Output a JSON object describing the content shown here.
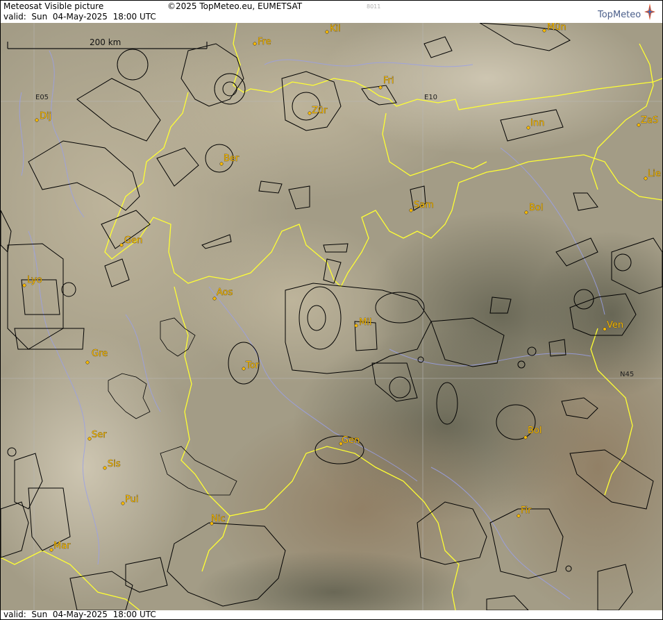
{
  "header": {
    "title": "Meteosat Visible picture",
    "copyright": "©2025 TopMeteo.eu, EUMETSAT",
    "image_id": "8011",
    "valid": "valid:  Sun  04-May-2025  18:00 UTC",
    "logo": "TopMeteo"
  },
  "footer": {
    "valid": "valid:  Sun  04-May-2025  18:00 UTC"
  },
  "scale_bar": {
    "label": "200 km"
  },
  "grid_labels": [
    "E05",
    "E10",
    "N45"
  ],
  "cities": [
    "Kil",
    "Mün",
    "Fre",
    "Fri",
    "Dij",
    "Zür",
    "Inn",
    "ZaS",
    "Ber",
    "Lie",
    "Sam",
    "Bol",
    "Gen",
    "Lyo",
    "Aos",
    "Mil",
    "Ven",
    "Gre",
    "Tor",
    "Ser",
    "Gen",
    "Bol",
    "Sis",
    "Pui",
    "Nic",
    "Fir",
    "Mar"
  ],
  "colors": {
    "border_line": "#ffff33",
    "rivers": "#9aa0e8",
    "airspace": "#000000",
    "city_marker": "#f5b800",
    "terrain_base": "#a39c86"
  }
}
